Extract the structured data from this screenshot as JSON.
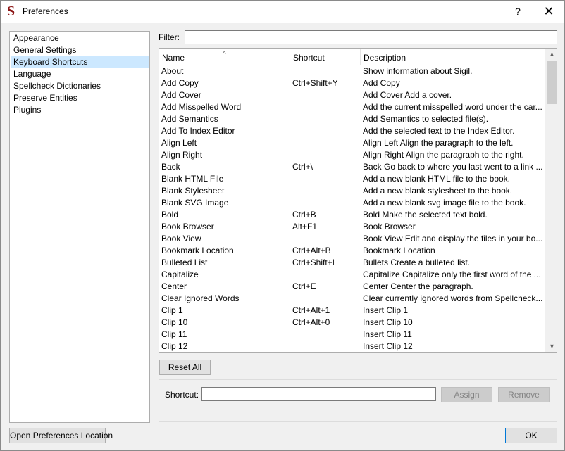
{
  "window": {
    "title": "Preferences",
    "help_label": "?",
    "close_label": "✕",
    "app_icon_letter": "S"
  },
  "categories": [
    {
      "label": "Appearance",
      "selected": false
    },
    {
      "label": "General Settings",
      "selected": false
    },
    {
      "label": "Keyboard Shortcuts",
      "selected": true
    },
    {
      "label": "Language",
      "selected": false
    },
    {
      "label": "Spellcheck Dictionaries",
      "selected": false
    },
    {
      "label": "Preserve Entities",
      "selected": false
    },
    {
      "label": "Plugins",
      "selected": false
    }
  ],
  "filter": {
    "label": "Filter:",
    "value": ""
  },
  "table": {
    "columns": {
      "name": "Name",
      "shortcut": "Shortcut",
      "description": "Description"
    },
    "sort_indicator": "^",
    "rows": [
      {
        "name": "About",
        "shortcut": "",
        "description": "Show information about Sigil."
      },
      {
        "name": "Add Copy",
        "shortcut": "Ctrl+Shift+Y",
        "description": "Add Copy"
      },
      {
        "name": "Add Cover",
        "shortcut": "",
        "description": "Add Cover Add a cover."
      },
      {
        "name": "Add Misspelled Word",
        "shortcut": "",
        "description": "Add the current misspelled word under the car..."
      },
      {
        "name": "Add Semantics",
        "shortcut": "",
        "description": "Add Semantics to selected file(s)."
      },
      {
        "name": "Add To Index Editor",
        "shortcut": "",
        "description": "Add the selected text to the Index Editor."
      },
      {
        "name": "Align Left",
        "shortcut": "",
        "description": "Align Left Align the paragraph to the left."
      },
      {
        "name": "Align Right",
        "shortcut": "",
        "description": "Align Right Align the paragraph to the right."
      },
      {
        "name": "Back",
        "shortcut": "Ctrl+\\",
        "description": "Back Go back to where you last went to a link ..."
      },
      {
        "name": "Blank HTML File",
        "shortcut": "",
        "description": "Add a new blank HTML file to the book."
      },
      {
        "name": "Blank Stylesheet",
        "shortcut": "",
        "description": "Add a new blank stylesheet to the book."
      },
      {
        "name": "Blank SVG Image",
        "shortcut": "",
        "description": "Add a new blank svg image file to the book."
      },
      {
        "name": "Bold",
        "shortcut": "Ctrl+B",
        "description": "Bold Make the selected text bold."
      },
      {
        "name": "Book Browser",
        "shortcut": "Alt+F1",
        "description": "Book Browser"
      },
      {
        "name": "Book View",
        "shortcut": "",
        "description": "Book View Edit and display the files in your bo..."
      },
      {
        "name": "Bookmark Location",
        "shortcut": "Ctrl+Alt+B",
        "description": "Bookmark Location"
      },
      {
        "name": "Bulleted List",
        "shortcut": "Ctrl+Shift+L",
        "description": "Bullets Create a bulleted list."
      },
      {
        "name": "Capitalize",
        "shortcut": "",
        "description": "Capitalize Capitalize only the first word of the ..."
      },
      {
        "name": "Center",
        "shortcut": "Ctrl+E",
        "description": "Center Center the paragraph."
      },
      {
        "name": "Clear Ignored Words",
        "shortcut": "",
        "description": "Clear currently ignored words from Spellcheck..."
      },
      {
        "name": "Clip 1",
        "shortcut": "Ctrl+Alt+1",
        "description": "Insert Clip 1"
      },
      {
        "name": "Clip 10",
        "shortcut": "Ctrl+Alt+0",
        "description": "Insert Clip 10"
      },
      {
        "name": "Clip 11",
        "shortcut": "",
        "description": "Insert Clip 11"
      },
      {
        "name": "Clip 12",
        "shortcut": "",
        "description": "Insert Clip 12"
      }
    ]
  },
  "buttons": {
    "reset_all": "Reset All",
    "assign": "Assign",
    "remove": "Remove",
    "open_location": "Open Preferences Location",
    "ok": "OK"
  },
  "shortcut_editor": {
    "label": "Shortcut:",
    "value": ""
  }
}
